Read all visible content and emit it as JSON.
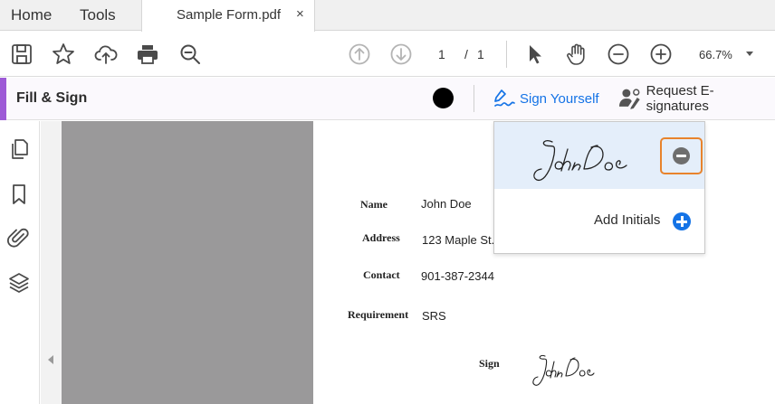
{
  "tabs": {
    "home": "Home",
    "tools": "Tools",
    "document": "Sample Form.pdf",
    "close": "×"
  },
  "toolbar": {
    "icons": [
      "save-icon",
      "bookmark-star-icon",
      "upload-cloud-icon",
      "print-icon",
      "search-zoom-icon",
      "page-up-icon",
      "page-down-icon",
      "select-arrow-icon",
      "hand-icon",
      "zoom-out-icon",
      "zoom-in-icon"
    ],
    "current_page": "1",
    "page_separator": "/",
    "total_pages": "1",
    "zoom": "66.7%"
  },
  "fill_sign": {
    "title": "Fill & Sign",
    "color": "#000000",
    "sign_yourself": "Sign Yourself",
    "request_esignatures": "Request E-signatures"
  },
  "left_nav": {
    "icons": [
      "pages-icon",
      "bookmark-icon",
      "attachment-icon",
      "layers-icon"
    ]
  },
  "form": {
    "fields": [
      {
        "label": "Name",
        "value": "John Doe"
      },
      {
        "label": "Address",
        "value": "123 Maple St."
      },
      {
        "label": "Contact",
        "value": "901-387-2344"
      },
      {
        "label": "Requirement",
        "value": "SRS"
      }
    ],
    "sign_label": "Sign"
  },
  "signature_popup": {
    "add_initials": "Add Initials"
  },
  "colors": {
    "accent_purple": "#9d5ad6",
    "link_blue": "#1473e6",
    "highlight_orange": "#e8832c",
    "canvas_gray": "#9a999a"
  }
}
